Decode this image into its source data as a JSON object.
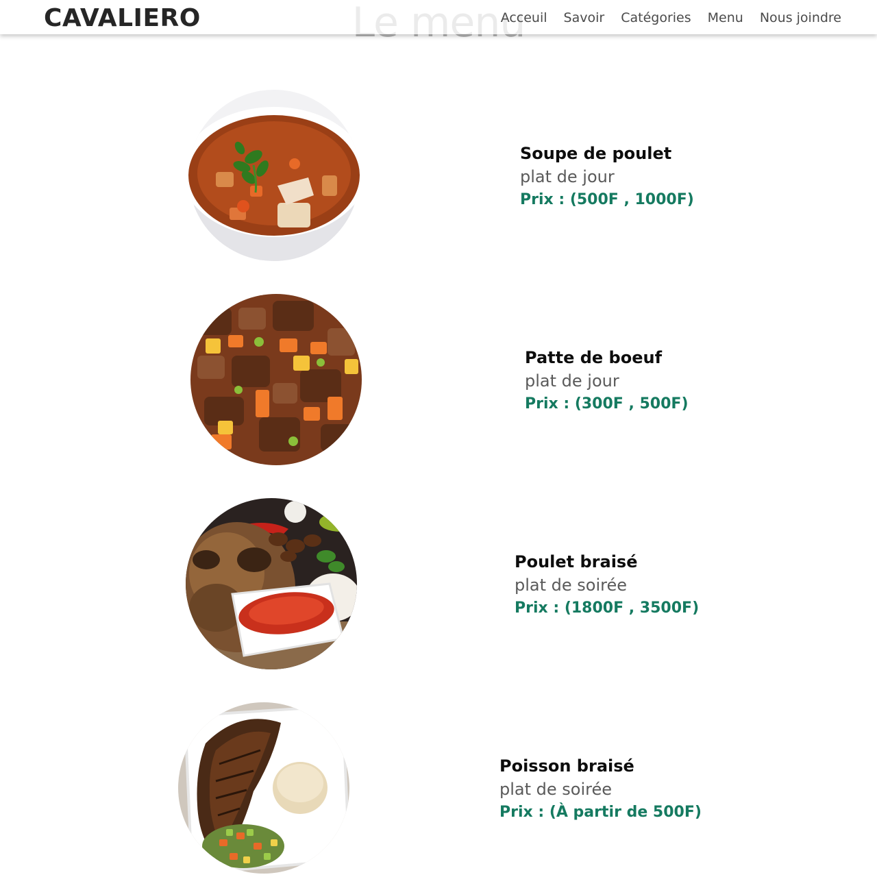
{
  "header": {
    "brand": "CAVALIERO",
    "nav": [
      "Acceuil",
      "Savoir",
      "Catégories",
      "Menu",
      "Nous joindre"
    ]
  },
  "page_title": "Le menu",
  "menu": [
    {
      "name": "Soupe de poulet",
      "kind": "plat de jour",
      "price": "Prix : (500F , 1000F)",
      "photo_icon": "chicken-soup-photo"
    },
    {
      "name": "Patte de boeuf",
      "kind": "plat de jour",
      "price": "Prix : (300F , 500F)",
      "photo_icon": "beef-stew-photo"
    },
    {
      "name": "Poulet braisé",
      "kind": "plat de soirée",
      "price": "Prix : (1800F , 3500F)",
      "photo_icon": "grilled-chicken-photo"
    },
    {
      "name": "Poisson braisé",
      "kind": "plat de soirée",
      "price": "Prix : (À partir de 500F)",
      "photo_icon": "grilled-fish-photo"
    }
  ],
  "colors": {
    "price": "#157a60",
    "brand": "#262626",
    "heading": "#b8b8b8"
  }
}
